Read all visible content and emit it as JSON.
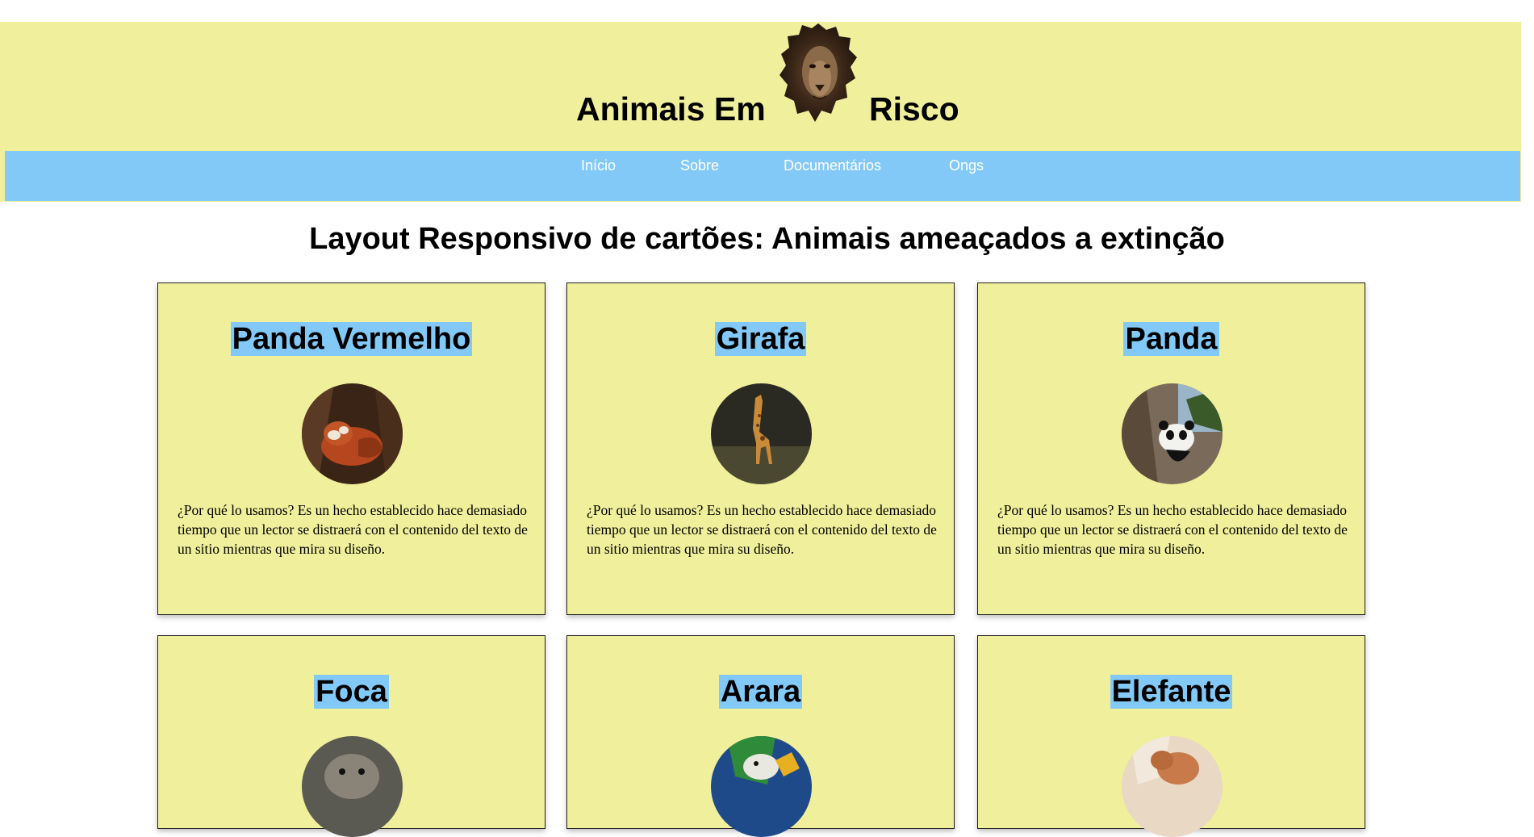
{
  "header": {
    "title_left": "Animais Em",
    "title_right": "Risco",
    "logo_icon": "lion-head-icon"
  },
  "nav": {
    "items": [
      {
        "label": "Início"
      },
      {
        "label": "Sobre"
      },
      {
        "label": "Documentários"
      },
      {
        "label": "Ongs"
      }
    ]
  },
  "main": {
    "heading": "Layout Responsivo de cartões: Animais ameaçados a extinção",
    "cards": [
      {
        "title": "Panda Vermelho",
        "photo": "red-panda-photo",
        "text": "¿Por qué lo usamos? Es un hecho establecido hace demasiado tiempo que un lector se distraerá con el contenido del texto de un sitio mientras que mira su diseño."
      },
      {
        "title": "Girafa",
        "photo": "giraffe-photo",
        "text": "¿Por qué lo usamos? Es un hecho establecido hace demasiado tiempo que un lector se distraerá con el contenido del texto de un sitio mientras que mira su diseño."
      },
      {
        "title": "Panda",
        "photo": "panda-photo",
        "text": "¿Por qué lo usamos? Es un hecho establecido hace demasiado tiempo que un lector se distraerá con el contenido del texto de un sitio mientras que mira su diseño."
      },
      {
        "title": "Foca",
        "photo": "seal-photo",
        "text": ""
      },
      {
        "title": "Arara",
        "photo": "macaw-photo",
        "text": ""
      },
      {
        "title": "Elefante",
        "photo": "elephant-photo",
        "text": ""
      }
    ]
  },
  "colors": {
    "header_bg": "#f0ef9b",
    "nav_bg": "#83c9f7",
    "card_bg": "#f0ef9b",
    "title_highlight": "#83c9f7"
  }
}
